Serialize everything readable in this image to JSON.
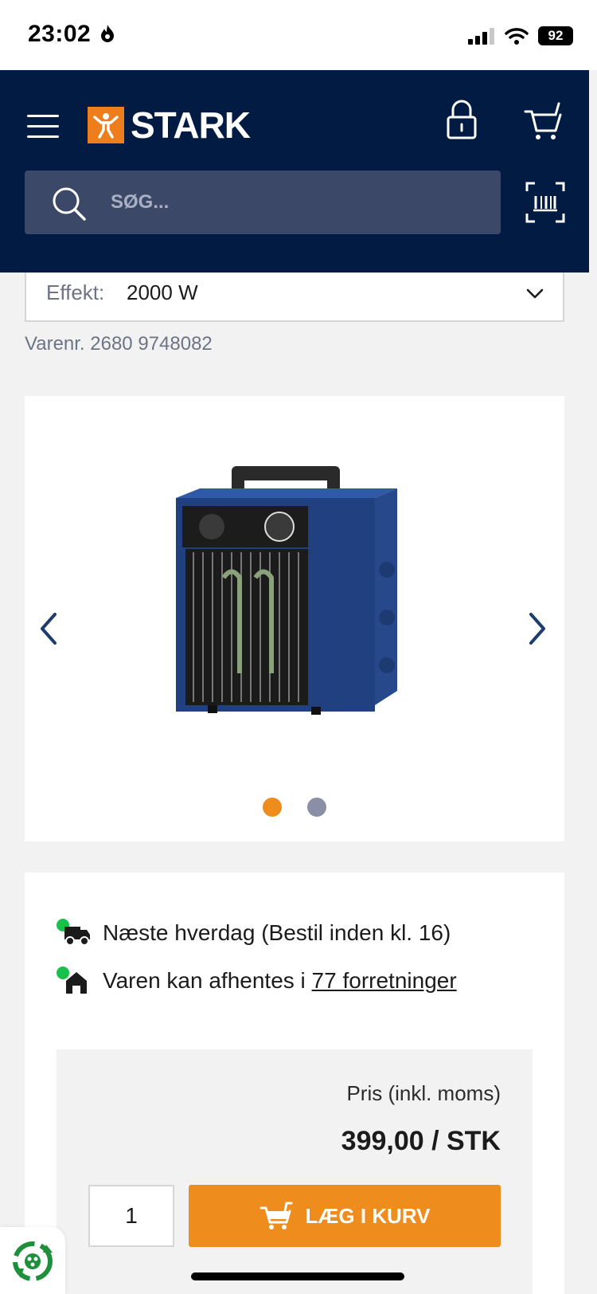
{
  "status_bar": {
    "time": "23:02",
    "battery": "92"
  },
  "header": {
    "logo_text": "STARK",
    "search": {
      "placeholder": "SØG..."
    }
  },
  "product": {
    "variant": {
      "label": "Effekt:",
      "value": "2000 W"
    },
    "sku": "Varenr. 2680 9748082"
  },
  "gallery": {
    "slide_count": 2,
    "active_slide": 1
  },
  "availability": {
    "delivery": "Næste hverdag (Bestil inden kl. 16)",
    "pickup_prefix": "Varen kan afhentes i ",
    "pickup_link": "77 forretninger"
  },
  "price": {
    "label": "Pris (inkl. moms)",
    "value": "399,00 / STK",
    "quantity": "1",
    "add_to_cart": "LÆG I KURV"
  },
  "colors": {
    "navy": "#021b42",
    "orange": "#ee8c1d",
    "green": "#16c24a"
  }
}
